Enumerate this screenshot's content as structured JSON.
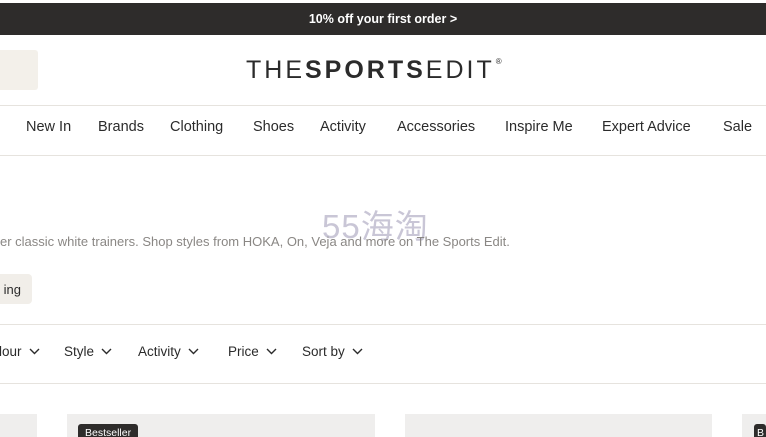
{
  "promo": {
    "text": "10% off your first order >"
  },
  "logo": {
    "part1": "THE",
    "part2": "SPORTS",
    "part3": "EDIT",
    "mark": "®"
  },
  "nav": {
    "items": [
      {
        "label": "New In"
      },
      {
        "label": "Brands"
      },
      {
        "label": "Clothing"
      },
      {
        "label": "Shoes"
      },
      {
        "label": "Activity"
      },
      {
        "label": "Accessories"
      },
      {
        "label": "Inspire Me"
      },
      {
        "label": "Expert Advice"
      },
      {
        "label": "Sale"
      }
    ]
  },
  "watermark": {
    "text": "55海淘"
  },
  "category": {
    "description": "er classic white trainers. Shop styles from HOKA, On, Veja and more on The Sports Edit.",
    "chip_label": "ing"
  },
  "filters": {
    "items": [
      {
        "label": "lour"
      },
      {
        "label": "Style"
      },
      {
        "label": "Activity"
      },
      {
        "label": "Price"
      },
      {
        "label": "Sort by"
      }
    ]
  },
  "products": {
    "badge_label": "Bestseller",
    "badge_partial": "B"
  },
  "colors": {
    "promo_bg": "#2e2c2b",
    "chip_bg": "#f1eee9",
    "card_bg": "#efeeed",
    "watermark": "#c9c6d6"
  },
  "icons": {
    "dropdown": "chevron-down-icon"
  }
}
